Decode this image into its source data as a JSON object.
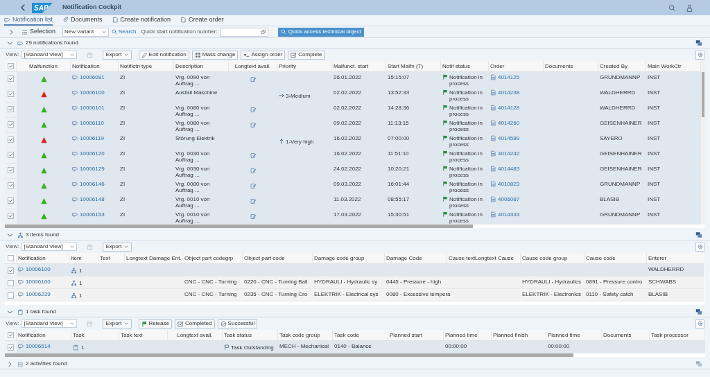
{
  "shell": {
    "logo": "SAP",
    "title": "Notification Cockpit"
  },
  "tabs": [
    {
      "label": "Notification list",
      "selected": true
    },
    {
      "label": "Documents",
      "selected": false
    },
    {
      "label": "Create notification",
      "selected": false
    },
    {
      "label": "Create order",
      "selected": false
    }
  ],
  "selection_bar": {
    "expanded": false,
    "label": "Selection",
    "variant": "New variant",
    "search": "Search",
    "quick_start_label": "Quick start notification number:",
    "quick_access": "Quick access technical object"
  },
  "sections": [
    {
      "kind": "notifications",
      "title": "29 notifications found",
      "expanded": true,
      "toolbar": {
        "view_label": "View:",
        "view": "[Standard View]",
        "buttons": [
          {
            "label": "Export",
            "kind": "menu"
          },
          {
            "label": "Edit notification",
            "kind": "edit"
          },
          {
            "label": "Mass change",
            "kind": "mass_change"
          },
          {
            "label": "Assign order",
            "kind": "assign"
          },
          {
            "label": "Complete",
            "kind": "complete"
          }
        ]
      },
      "table": {
        "all_checked": true,
        "columns": [
          "Malfunction",
          "Notification",
          "Notifictn type",
          "Description",
          "Longtext avail.",
          "Priority",
          "Malfunct. start",
          "Start Malfn (T)",
          "Notif status",
          "Order",
          "Documents",
          "Created By",
          "Main WorkCtr"
        ],
        "rows": [
          {
            "selected": true,
            "cells": [
              {
                "kind": "triangle",
                "color": "#3cae24"
              },
              {
                "kind": "notification_link",
                "text": "10006081"
              },
              {
                "text": "ZI"
              },
              {
                "text": "Vrg. 0090 von Auftrag ..."
              },
              {
                "kind": "longtext"
              },
              {},
              {
                "text": "26.01.2022"
              },
              {
                "text": "15:15:07"
              },
              {
                "kind": "status",
                "text": "Notification in process"
              },
              {
                "kind": "order_link",
                "text": "4014125"
              },
              {},
              {
                "text": "GRUNDMANNP"
              },
              {
                "text": "INST"
              }
            ]
          },
          {
            "selected": true,
            "cells": [
              {
                "kind": "triangle",
                "color": "#d8281c"
              },
              {
                "kind": "notification_link",
                "text": "10006100"
              },
              {
                "text": "ZI"
              },
              {
                "text": "Ausfall Maschine"
              },
              {},
              {
                "kind": "priority_right",
                "text": "3-Medium"
              },
              {
                "text": "02.02.2022"
              },
              {
                "text": "13:52:33"
              },
              {
                "kind": "status",
                "text": "Notification in process"
              },
              {
                "kind": "order_link",
                "text": "4014238"
              },
              {},
              {
                "text": "WALDHERRD"
              },
              {
                "text": "INST"
              }
            ]
          },
          {
            "selected": true,
            "cells": [
              {
                "kind": "triangle",
                "color": "#3cae24"
              },
              {
                "kind": "notification_link",
                "text": "10006101"
              },
              {
                "text": "ZI"
              },
              {
                "text": "Vrg. 0080 von Auftrag ..."
              },
              {
                "kind": "longtext"
              },
              {},
              {
                "text": "02.02.2022"
              },
              {
                "text": "14:28:36"
              },
              {
                "kind": "status",
                "text": "Notification in process"
              },
              {
                "kind": "order_link",
                "text": "4014128"
              },
              {},
              {
                "text": "WALDHERRD"
              },
              {
                "text": "INST"
              }
            ]
          },
          {
            "selected": true,
            "cells": [
              {
                "kind": "triangle",
                "color": "#3cae24"
              },
              {
                "kind": "notification_link",
                "text": "10006110"
              },
              {
                "text": "ZI"
              },
              {
                "text": "Vrg. 0080 von Auftrag ..."
              },
              {
                "kind": "longtext"
              },
              {},
              {
                "text": "09.02.2022"
              },
              {
                "text": "11:13:15"
              },
              {
                "kind": "status",
                "text": "Notification in process"
              },
              {
                "kind": "order_link",
                "text": "4014260"
              },
              {},
              {
                "text": "GEISENHAINER"
              },
              {
                "text": "INST"
              }
            ]
          },
          {
            "selected": true,
            "cells": [
              {
                "kind": "triangle",
                "color": "#d8281c"
              },
              {
                "kind": "notification_link",
                "text": "10006119"
              },
              {
                "text": "ZI"
              },
              {
                "text": "Störung Elektrik"
              },
              {},
              {
                "kind": "priority_up",
                "text": "1-Very high"
              },
              {
                "text": "16.02.2022"
              },
              {
                "text": "07:00:00"
              },
              {
                "kind": "status",
                "text": "Notification in process"
              },
              {
                "kind": "order_link",
                "text": "4014589"
              },
              {},
              {
                "text": "SAYERO"
              },
              {
                "text": "INST"
              }
            ]
          },
          {
            "selected": true,
            "cells": [
              {
                "kind": "triangle",
                "color": "#3cae24"
              },
              {
                "kind": "notification_link",
                "text": "10006120"
              },
              {
                "text": "ZI"
              },
              {
                "text": "Vrg. 0030 von Auftrag ..."
              },
              {
                "kind": "longtext"
              },
              {},
              {
                "text": "16.02.2022"
              },
              {
                "text": "11:51:10"
              },
              {
                "kind": "status",
                "text": "Notification in process"
              },
              {
                "kind": "order_link",
                "text": "4014242"
              },
              {},
              {
                "text": "GEISENHAINER"
              },
              {
                "text": "INST"
              }
            ]
          },
          {
            "selected": true,
            "cells": [
              {
                "kind": "triangle",
                "color": "#3cae24"
              },
              {
                "kind": "notification_link",
                "text": "10006129"
              },
              {
                "text": "ZI"
              },
              {
                "text": "Vrg. 0030 von Auftrag ..."
              },
              {
                "kind": "longtext"
              },
              {},
              {
                "text": "24.02.2022"
              },
              {
                "text": "10:20:21"
              },
              {
                "kind": "status",
                "text": "Notification in process"
              },
              {
                "kind": "order_link",
                "text": "4014483"
              },
              {},
              {
                "text": "GEISENHAINER"
              },
              {
                "text": "INST"
              }
            ]
          },
          {
            "selected": true,
            "cells": [
              {
                "kind": "triangle",
                "color": "#3cae24"
              },
              {
                "kind": "notification_link",
                "text": "10006146"
              },
              {
                "text": "ZI"
              },
              {
                "text": "Vrg. 0080 von Auftrag ..."
              },
              {
                "kind": "longtext"
              },
              {},
              {
                "text": "09.03.2022"
              },
              {
                "text": "16:01:44"
              },
              {
                "kind": "status",
                "text": "Notification in process"
              },
              {
                "kind": "order_link",
                "text": "4010823"
              },
              {},
              {
                "text": "GRUNDMANNP"
              },
              {
                "text": "INST"
              }
            ]
          },
          {
            "selected": true,
            "cells": [
              {
                "kind": "triangle",
                "color": "#3cae24"
              },
              {
                "kind": "notification_link",
                "text": "10006148"
              },
              {
                "text": "ZI"
              },
              {
                "text": "Vrg. 0010 von Auftrag ..."
              },
              {
                "kind": "longtext"
              },
              {},
              {
                "text": "11.03.2022"
              },
              {
                "text": "08:55:17"
              },
              {
                "kind": "status",
                "text": "Notification in process"
              },
              {
                "kind": "order_link",
                "text": "4006087"
              },
              {},
              {
                "text": "BLASIB"
              },
              {
                "text": "INST"
              }
            ]
          },
          {
            "selected": true,
            "cells": [
              {
                "kind": "triangle",
                "color": "#3cae24"
              },
              {
                "kind": "notification_link",
                "text": "10006153"
              },
              {
                "text": "ZI"
              },
              {
                "text": "Vrg. 0010 von Auftrag ..."
              },
              {
                "kind": "longtext"
              },
              {},
              {
                "text": "17.03.2022"
              },
              {
                "text": "15:30:51"
              },
              {
                "kind": "status",
                "text": "Notification in process"
              },
              {
                "kind": "order_link",
                "text": "4014333"
              },
              {},
              {
                "text": "GRUNDMANNP"
              },
              {
                "text": "INST"
              }
            ]
          }
        ]
      }
    },
    {
      "kind": "items",
      "title": "3 items found",
      "expanded": true,
      "toolbar": {
        "view_label": "View:",
        "view": "[Standard View]",
        "buttons": [
          {
            "label": "Export",
            "kind": "menu"
          }
        ]
      },
      "table": {
        "all_checked": false,
        "columns": [
          "Notification",
          "Item",
          "Text",
          "Longtext Damage Ent.",
          "Object part codegrp",
          "Object part code",
          "Damage code group",
          "Damage Code",
          "Cause text",
          "Longtext Cause",
          "Cause code group",
          "Cause code",
          "Enterer"
        ],
        "rows": [
          {
            "selected": true,
            "cells": [
              {
                "kind": "notification_link",
                "text": "10006100"
              },
              {
                "kind": "item",
                "text": "1"
              },
              {},
              {},
              {},
              {},
              {},
              {},
              {},
              {},
              {},
              {},
              {
                "text": "WALDHERRD"
              }
            ]
          },
          {
            "selected": false,
            "cells": [
              {
                "kind": "notification_link",
                "text": "10006160"
              },
              {
                "kind": "item",
                "text": "1"
              },
              {},
              {},
              {
                "text": "CNC - CNC - Turning"
              },
              {
                "text": "0220 - CNC - Turning Ball"
              },
              {
                "text": "HYDRAULI - Hydraulic sy"
              },
              {
                "text": "0445 - Pressure - high"
              },
              {},
              {},
              {
                "text": "HYDRAULI - Hydraulics"
              },
              {
                "text": "0891 - Pressure contro"
              },
              {
                "text": "SCHWABS"
              }
            ]
          },
          {
            "selected": false,
            "cells": [
              {
                "kind": "notification_link",
                "text": "10006239"
              },
              {
                "kind": "item",
                "text": "1"
              },
              {},
              {},
              {
                "text": "CNC - CNC - Turning"
              },
              {
                "text": "0235 - CNC - Turning Cro"
              },
              {
                "text": "ELEKTRIK - Electrical sys"
              },
              {
                "text": "0080 - Excessive tempera"
              },
              {},
              {},
              {
                "text": "ELEKTRIK - Electronics"
              },
              {
                "text": "0110 - Safety catch"
              },
              {
                "text": "BLASIB"
              }
            ]
          }
        ]
      }
    },
    {
      "kind": "tasks",
      "title": "1 task found",
      "expanded": true,
      "toolbar": {
        "view_label": "View:",
        "view": "[Standard View]",
        "buttons": [
          {
            "label": "Export",
            "kind": "menu"
          },
          {
            "label": "Release",
            "kind": "release"
          },
          {
            "label": "Completed",
            "kind": "completed"
          },
          {
            "label": "Successful",
            "kind": "successful"
          }
        ]
      },
      "table": {
        "all_checked": true,
        "columns": [
          "Notification",
          "Task",
          "Task text",
          "Longtext avail.",
          "Task status",
          "Task code group",
          "Task code",
          "Planned start",
          "Planned time",
          "Planned finish",
          "Planned time",
          "Documents",
          "Task processor"
        ],
        "rows": [
          {
            "selected": true,
            "cells": [
              {
                "kind": "notification_link",
                "text": "10006614"
              },
              {
                "kind": "task",
                "text": "1"
              },
              {},
              {},
              {
                "kind": "task_status",
                "text": "Task Outstanding"
              },
              {
                "text": "MECH - Mechanical"
              },
              {
                "text": "0140 - Balance"
              },
              {},
              {
                "text": "00:00:00"
              },
              {},
              {
                "text": "00:00:00"
              },
              {},
              {}
            ]
          }
        ]
      }
    },
    {
      "kind": "activities",
      "title": "2 activities found",
      "expanded": false
    }
  ]
}
